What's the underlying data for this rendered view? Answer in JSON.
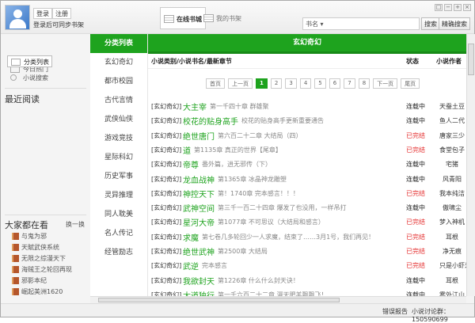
{
  "header": {
    "login": "登录",
    "register": "注册",
    "sync_hint": "登录后可同步书架",
    "tab_online": "在线书城",
    "tab_shelf": "我的书架",
    "search_type": "书名 ▾",
    "search": "搜索",
    "exact_search": "精确搜索"
  },
  "left": {
    "nav": [
      "今日热门",
      "分类列表",
      "小说搜索"
    ],
    "recent": "最近阅读",
    "popular": "大家都在看",
    "refresh": "换一换",
    "popular_books": [
      "与鬼为邪",
      "天賦武侠系统",
      "无限之综漫天下",
      "海贼王之轮回再现",
      "邪影本纪",
      "崛起美洲1620"
    ]
  },
  "categories": [
    "分类列表",
    "玄幻奇幻",
    "都市校园",
    "古代言情",
    "武侠仙侠",
    "游戏竞技",
    "星际科幻",
    "历史军事",
    "灵异推理",
    "同人耽美",
    "名人传记",
    "经管励志"
  ],
  "main": {
    "title": "玄幻奇幻",
    "col_book": "小说类别/小说书名/最新章节",
    "col_status": "状态",
    "col_author": "小说作者",
    "pager": [
      "首页",
      "上一页",
      "1",
      "2",
      "3",
      "4",
      "5",
      "6",
      "7",
      "8",
      "下一页",
      "尾页"
    ],
    "current_page": "1",
    "rows": [
      {
        "cat": "[玄幻奇幻]",
        "title": "大主宰",
        "chapter": "第一千四十章 群雄聚",
        "status": "连载中",
        "author": "天蚕土豆"
      },
      {
        "cat": "[玄幻奇幻]",
        "title": "校花的贴身高手",
        "chapter": "校花的贴身高手更新重要通告",
        "status": "连载中",
        "author": "鱼人二代"
      },
      {
        "cat": "[玄幻奇幻]",
        "title": "绝世唐门",
        "chapter": "第六百二十二章 大结局（四）",
        "status": "已完结",
        "author": "唐家三少"
      },
      {
        "cat": "[玄幻奇幻]",
        "title": "道",
        "chapter": "第1135章 真正的世界【尾章】",
        "status": "已完结",
        "author": "食堂包子"
      },
      {
        "cat": "[玄幻奇幻]",
        "title": "帝尊",
        "chapter": "番外篇，逍无邪传（下）",
        "status": "连载中",
        "author": "宅猪"
      },
      {
        "cat": "[玄幻奇幻]",
        "title": "龙血战神",
        "chapter": "第1365章 冰晶神龙雕塑",
        "status": "连载中",
        "author": "风青阳"
      },
      {
        "cat": "[玄幻奇幻]",
        "title": "神控天下",
        "chapter": "第！1740章 完本感言！！！",
        "status": "已完结",
        "author": "我本纯洁"
      },
      {
        "cat": "[玄幻奇幻]",
        "title": "武神空间",
        "chapter": "第三千一百二十四章 爆发了也没用，一样吊打",
        "status": "连载中",
        "author": "傲啸尘"
      },
      {
        "cat": "[玄幻奇幻]",
        "title": "星河大帝",
        "chapter": "第1077章 不可思议（大结局和感言）",
        "status": "已完结",
        "author": "梦入神机"
      },
      {
        "cat": "[玄幻奇幻]",
        "title": "求魔",
        "chapter": "第七卷几多轮回少一人求魔，结束了……3月1号，我们再见！",
        "status": "已完结",
        "author": "耳根"
      },
      {
        "cat": "[玄幻奇幻]",
        "title": "绝世武神",
        "chapter": "第2500章 大结局",
        "status": "已完结",
        "author": "净无痕"
      },
      {
        "cat": "[玄幻奇幻]",
        "title": "武逆",
        "chapter": "完本感言",
        "status": "已完结",
        "author": "只是小虾米"
      },
      {
        "cat": "[玄幻奇幻]",
        "title": "我欲封天",
        "chapter": "第1226章 什么什么封天诀！",
        "status": "连载中",
        "author": "耳根"
      },
      {
        "cat": "[玄幻奇幻]",
        "title": "大道独行",
        "chapter": "第一千六百二十二章 漫天肥羊飘飘飞！",
        "status": "连载中",
        "author": "雾外江山"
      }
    ]
  },
  "status": {
    "error_report": "错误报告",
    "group": "小说讨论群：150590699"
  },
  "colors": {
    "accent": "#1ea31e",
    "done": "#e53030"
  }
}
